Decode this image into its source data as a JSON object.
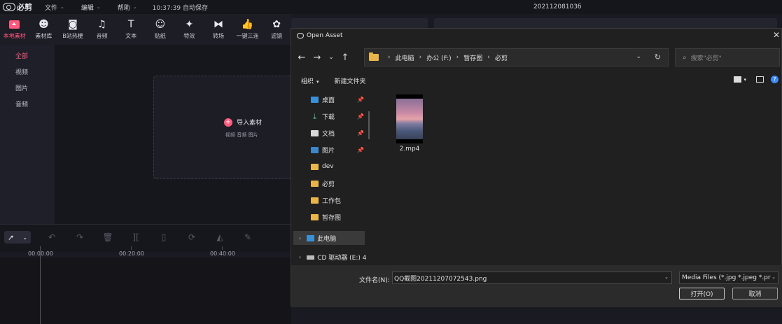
{
  "app": {
    "name": "必剪",
    "menu": [
      "文件",
      "编辑",
      "帮助"
    ],
    "clock_status": "10:37:39 自动保存",
    "project_name": "20211208103б"
  },
  "toolbar": [
    {
      "label": "本地素材",
      "icon": "upload-icon",
      "active": true
    },
    {
      "label": "素材库",
      "icon": "library-icon"
    },
    {
      "label": "B站热梗",
      "icon": "bilibili-icon"
    },
    {
      "label": "音频",
      "icon": "music-icon"
    },
    {
      "label": "文本",
      "icon": "text-icon"
    },
    {
      "label": "贴纸",
      "icon": "sticker-icon"
    },
    {
      "label": "特效",
      "icon": "effects-icon"
    },
    {
      "label": "转场",
      "icon": "transition-icon"
    },
    {
      "label": "一键三连",
      "icon": "like-icon"
    },
    {
      "label": "滤镜",
      "icon": "filter-icon"
    }
  ],
  "sidebar": [
    "全部",
    "视频",
    "图片",
    "音频"
  ],
  "import": {
    "label": "导入素材",
    "sub": "视频 音频 图片"
  },
  "timeline": {
    "ticks": [
      "00:00:00",
      "00:20:00",
      "00:40:00"
    ]
  },
  "dialog": {
    "title": "Open Asset",
    "breadcrumbs": [
      "此电脑",
      "办公 (F:)",
      "暂存图",
      "必剪"
    ],
    "search_placeholder": "搜索\"必剪\"",
    "organize": "组织",
    "new_folder": "新建文件夹",
    "quick_access": [
      {
        "label": "桌面",
        "pinned": true,
        "icon": "desktop-icon"
      },
      {
        "label": "下载",
        "pinned": true,
        "icon": "download-icon"
      },
      {
        "label": "文档",
        "pinned": true,
        "icon": "document-icon"
      },
      {
        "label": "图片",
        "pinned": true,
        "icon": "pictures-icon"
      },
      {
        "label": "dev",
        "pinned": false,
        "icon": "folder-icon"
      },
      {
        "label": "必剪",
        "pinned": false,
        "icon": "folder-icon"
      },
      {
        "label": "工作包",
        "pinned": false,
        "icon": "folder-icon"
      },
      {
        "label": "暂存图",
        "pinned": false,
        "icon": "folder-icon"
      }
    ],
    "this_pc": "此电脑",
    "cd_drive": "CD 驱动器 (E:) 4",
    "files": [
      {
        "name": "2.mp4"
      }
    ],
    "filename_label": "文件名(N):",
    "filename_value": "QQ截图20211207072543.png",
    "filetype_value": "Media Files (*.jpg *.jpeg *.pr",
    "open_button": "打开(O)",
    "cancel_button": "取消"
  },
  "colors": {
    "accent": "#ff5a7d",
    "folder": "#e8b54a"
  }
}
